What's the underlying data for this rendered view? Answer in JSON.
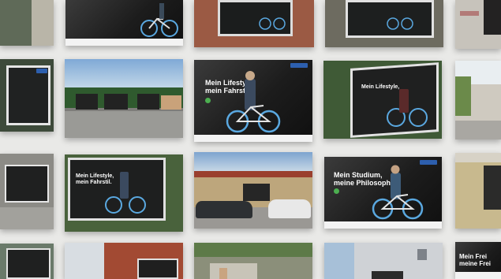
{
  "posters": {
    "lifestyle": {
      "headline": "Mein Lifestyle,\nmein Fahrstil."
    },
    "studium": {
      "headline": "Mein Studium,\nmeine Philosophie."
    },
    "bottom_right": {
      "headline": "Mein Frei\nmeine Frei"
    }
  },
  "colors": {
    "background": "#e9e9e7",
    "brand_blue": "#2d5fae",
    "badge_green": "#4caf50",
    "bike_blue": "#5aa8e0"
  }
}
